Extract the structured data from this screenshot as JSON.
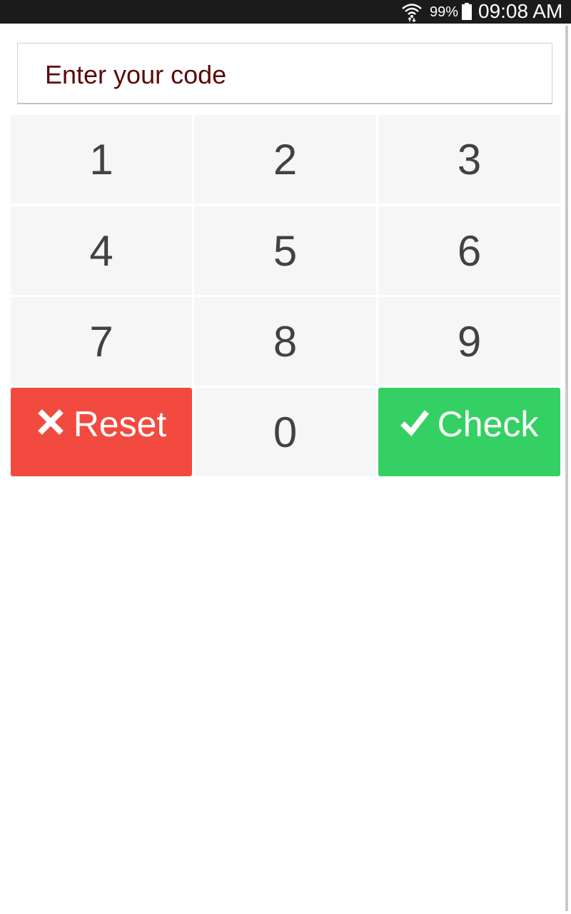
{
  "status_bar": {
    "battery": "99%",
    "time": "09:08 AM",
    "icons": [
      "wifi-icon",
      "battery-icon"
    ]
  },
  "code_input": {
    "placeholder": "Enter your code",
    "value": ""
  },
  "keypad": {
    "keys": [
      "1",
      "2",
      "3",
      "4",
      "5",
      "6",
      "7",
      "8",
      "9",
      "0"
    ],
    "reset_label": "Reset",
    "check_label": "Check",
    "reset_icon": "close-icon",
    "check_icon": "checkmark-icon"
  },
  "colors": {
    "status_bar": "#1b1b1b",
    "key_background": "#f6f6f6",
    "key_text": "#424242",
    "reset": "#f24a3e",
    "check": "#35d063",
    "placeholder": "#5a0a0a"
  }
}
